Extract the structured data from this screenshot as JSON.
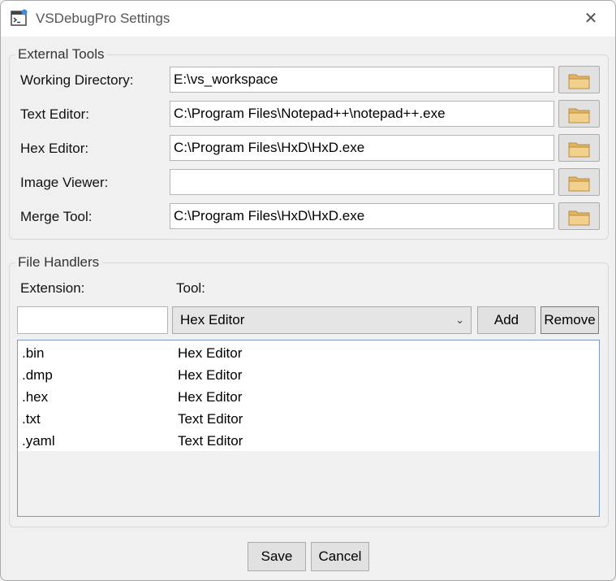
{
  "window": {
    "title": "VSDebugPro Settings"
  },
  "external_tools": {
    "legend": "External Tools",
    "fields": [
      {
        "label": "Working Directory:",
        "value": "E:\\vs_workspace"
      },
      {
        "label": "Text Editor:",
        "value": "C:\\Program Files\\Notepad++\\notepad++.exe"
      },
      {
        "label": "Hex Editor:",
        "value": "C:\\Program Files\\HxD\\HxD.exe"
      },
      {
        "label": "Image Viewer:",
        "value": ""
      },
      {
        "label": "Merge Tool:",
        "value": "C:\\Program Files\\HxD\\HxD.exe"
      }
    ]
  },
  "file_handlers": {
    "legend": "File Handlers",
    "extension_label": "Extension:",
    "tool_label": "Tool:",
    "extension_value": "",
    "tool_selected": "Hex Editor",
    "add_label": "Add",
    "remove_label": "Remove",
    "rows": [
      {
        "extension": ".bin",
        "tool": "Hex Editor"
      },
      {
        "extension": ".dmp",
        "tool": "Hex Editor"
      },
      {
        "extension": ".hex",
        "tool": "Hex Editor"
      },
      {
        "extension": ".txt",
        "tool": "Text Editor"
      },
      {
        "extension": ".yaml",
        "tool": "Text Editor"
      }
    ]
  },
  "footer": {
    "save_label": "Save",
    "cancel_label": "Cancel"
  },
  "icons": {
    "close": "close-icon",
    "folder": "folder-icon",
    "app": "app-icon",
    "dropdown": "chevron-down-icon"
  },
  "colors": {
    "folder": "#e2b467",
    "list_border": "#7a9cc0"
  }
}
